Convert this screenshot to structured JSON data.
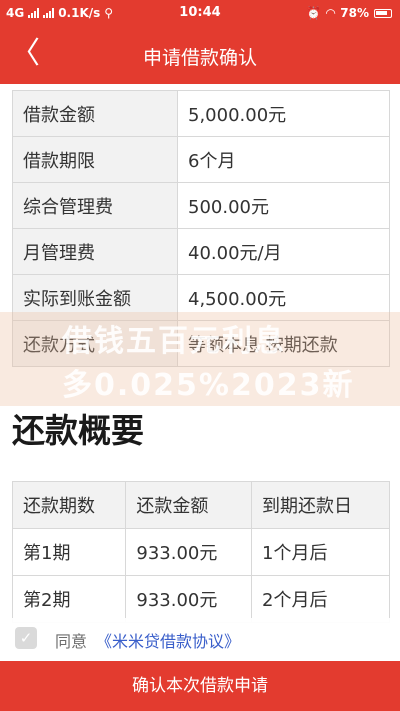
{
  "status_bar": {
    "network": "4G",
    "speed": "0.1K/s",
    "time": "10:44",
    "battery": "78%"
  },
  "header": {
    "back_glyph": "〈",
    "title": "申请借款确认"
  },
  "loan_details": [
    {
      "label": "借款金额",
      "value": "5,000.00元"
    },
    {
      "label": "借款期限",
      "value": "6个月"
    },
    {
      "label": "综合管理费",
      "value": "500.00元"
    },
    {
      "label": "月管理费",
      "value": "40.00元/月"
    },
    {
      "label": "实际到账金额",
      "value": "4,500.00元"
    },
    {
      "label": "还款方式",
      "value": "等额本息 按期还款"
    }
  ],
  "watermark": {
    "line1": "借钱五百元利息",
    "line2": "多0.025%2023新"
  },
  "repayment_summary": {
    "title": "还款概要",
    "columns": [
      "还款期数",
      "还款金额",
      "到期还款日"
    ],
    "rows": [
      [
        "第1期",
        "933.00元",
        "1个月后"
      ],
      [
        "第2期",
        "933.00元",
        "2个月后"
      ]
    ]
  },
  "agreement": {
    "prefix": "同意",
    "link": "《米米贷借款协议》",
    "checked": true
  },
  "footer": {
    "submit_label": "确认本次借款申请"
  },
  "colors": {
    "brand_red": "#e33b2f",
    "link_blue": "#2f56c8"
  }
}
